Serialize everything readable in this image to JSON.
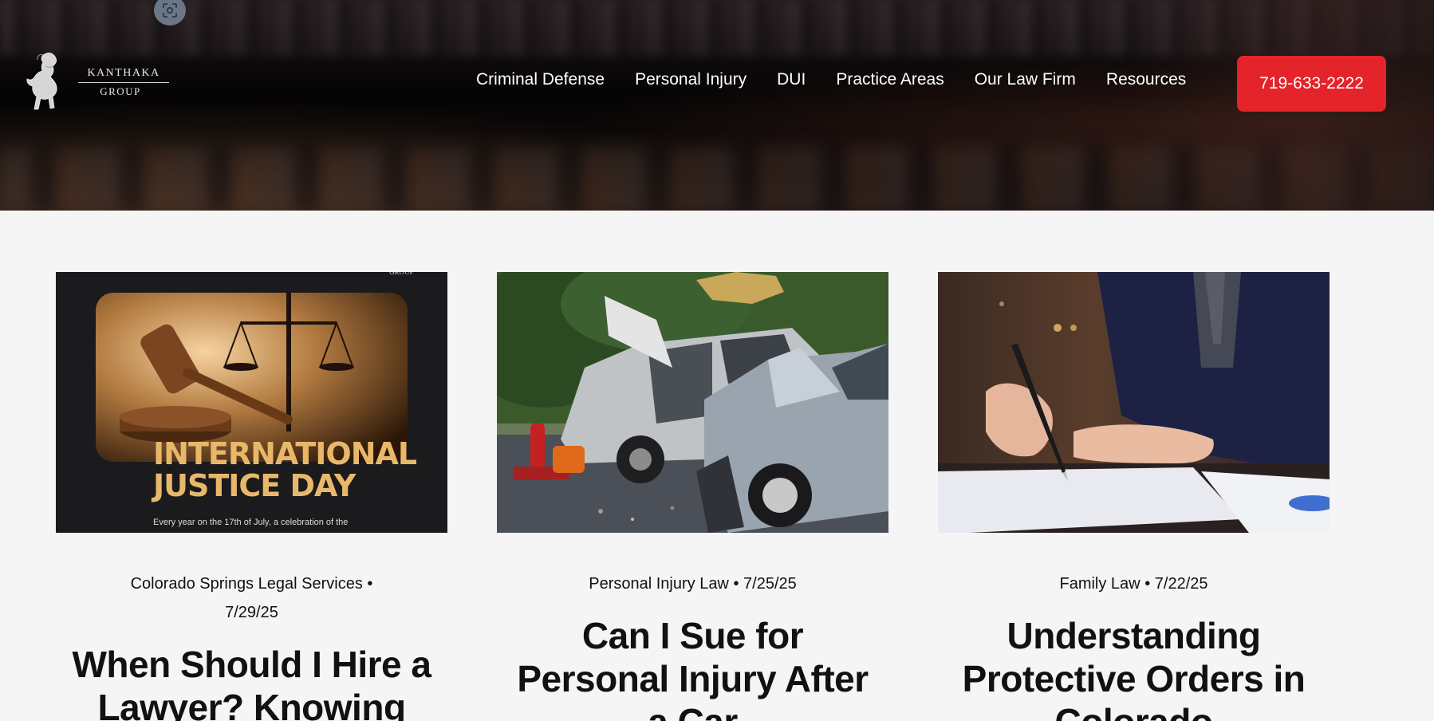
{
  "header": {
    "logo_line1": "KANTHAKA",
    "logo_line2": "GROUP",
    "nav": [
      {
        "label": "Criminal Defense"
      },
      {
        "label": "Personal Injury"
      },
      {
        "label": "DUI"
      },
      {
        "label": "Practice Areas"
      },
      {
        "label": "Our Law Firm"
      },
      {
        "label": "Resources"
      }
    ],
    "phone": "719-633-2222"
  },
  "posts": [
    {
      "category": "Colorado Springs Legal Services",
      "date": "7/29/25",
      "title": "When Should I Hire a Lawyer? Knowing",
      "image_heading_1": "INTERNATIONAL",
      "image_heading_2": "JUSTICE DAY",
      "image_caption": "Every year on the 17th of July, a celebration of the"
    },
    {
      "category": "Personal Injury Law",
      "date": "7/25/25",
      "title": "Can I Sue for Personal Injury After a Car"
    },
    {
      "category": "Family Law",
      "date": "7/22/25",
      "title": "Understanding Protective Orders in Colorado"
    }
  ],
  "separator": "•",
  "colors": {
    "accent": "#e4242a",
    "page_bg": "#f5f5f5",
    "header_bg": "#0a0707"
  },
  "icons": {
    "capture": "screen-capture-icon",
    "logo": "rearing-horse-logo-icon"
  }
}
